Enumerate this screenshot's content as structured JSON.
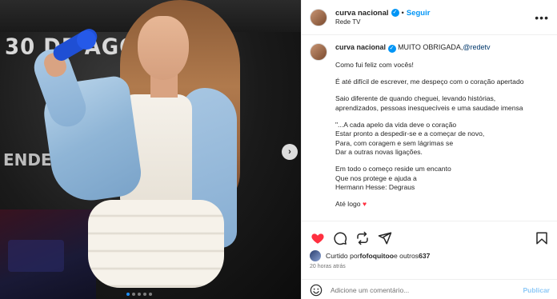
{
  "media": {
    "bg_text_1": "30 DE AGOSTO 26",
    "bg_text_2": "ENDENTE",
    "next_icon": "chevron-right-icon"
  },
  "header": {
    "username": "curva nacional",
    "separator": "•",
    "follow_label": "Seguir",
    "subtitle": "Rede TV",
    "more_icon": "more-horizontal-icon"
  },
  "caption": {
    "username": "curva nacional",
    "first_line_text": "MUITO OBRIGADA,",
    "mention": "@redetv",
    "paragraphs": [
      [
        "Como fui feliz com vocês!"
      ],
      [
        "É até difícil de escrever, me despeço com o coração apertado"
      ],
      [
        "Saio diferente de quando cheguei, levando histórias,",
        "aprendizados, pessoas inesquecíveis e uma saudade imensa"
      ],
      [
        "\"...A cada apelo da vida deve o coração",
        "Estar pronto a despedir-se e a começar de novo,",
        "Para, com coragem e sem lágrimas se",
        "Dar a outras novas ligações."
      ],
      [
        "Em todo o começo reside um encanto",
        "Que nos protege e ajuda a",
        "Hermann Hesse: Degraus"
      ]
    ],
    "last_line": "Até logo",
    "last_emoji": "♥"
  },
  "actions": {
    "like_icon": "heart-icon",
    "comment_icon": "comment-icon",
    "share_icon": "share-icon",
    "bookmark_icon": "bookmark-icon"
  },
  "likes": {
    "prefix": "Curtido por",
    "user": "fofoquitoo",
    "middle": "e outros",
    "count": "637"
  },
  "time_ago": "20 horas atrás",
  "comment": {
    "placeholder": "Adicione um comentário...",
    "publish_label": "Publicar",
    "emoji_icon": "emoji-icon"
  },
  "colors": {
    "accent": "#0095f6",
    "like_red": "#ff3040",
    "publish_disabled": "#8ec9f7"
  }
}
